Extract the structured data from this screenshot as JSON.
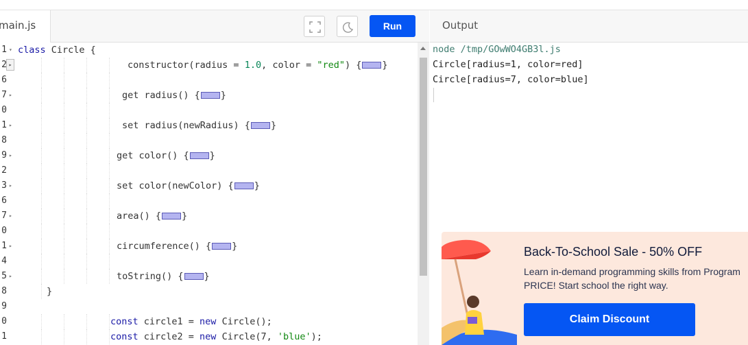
{
  "editor": {
    "file_tab": "main.js",
    "run_label": "Run",
    "icons": {
      "fullscreen": "fullscreen-icon",
      "theme": "moon-icon"
    },
    "lines": [
      {
        "num": "1",
        "fold": "open",
        "indent": 26,
        "guides": 0,
        "parts": [
          [
            "kw",
            "class"
          ],
          [
            "p",
            " Circle {"
          ]
        ]
      },
      {
        "num": "2",
        "fold": "box",
        "indent": 186,
        "guides": 4,
        "parts": [
          [
            "p",
            "constructor(radius = "
          ],
          [
            "num",
            "1.0"
          ],
          [
            "p",
            ", color = "
          ],
          [
            "str",
            "\"red\""
          ],
          [
            "p",
            ") {"
          ],
          [
            "mark",
            ""
          ],
          [
            "p",
            "}"
          ]
        ]
      },
      {
        "num": "6",
        "fold": "",
        "indent": 0,
        "guides": 4,
        "parts": []
      },
      {
        "num": "7",
        "fold": "closed",
        "indent": 178,
        "guides": 4,
        "parts": [
          [
            "p",
            "get radius() {"
          ],
          [
            "mark",
            ""
          ],
          [
            "p",
            "}"
          ]
        ]
      },
      {
        "num": "0",
        "fold": "",
        "indent": 0,
        "guides": 4,
        "parts": []
      },
      {
        "num": "1",
        "fold": "closed",
        "indent": 178,
        "guides": 4,
        "parts": [
          [
            "p",
            "set radius(newRadius) {"
          ],
          [
            "mark",
            ""
          ],
          [
            "p",
            "}"
          ]
        ]
      },
      {
        "num": "8",
        "fold": "",
        "indent": 0,
        "guides": 4,
        "parts": []
      },
      {
        "num": "9",
        "fold": "closed",
        "indent": 170,
        "guides": 4,
        "parts": [
          [
            "p",
            "get color() {"
          ],
          [
            "mark",
            ""
          ],
          [
            "p",
            "}"
          ]
        ]
      },
      {
        "num": "2",
        "fold": "",
        "indent": 0,
        "guides": 4,
        "parts": []
      },
      {
        "num": "3",
        "fold": "closed",
        "indent": 170,
        "guides": 4,
        "parts": [
          [
            "p",
            "set color(newColor) {"
          ],
          [
            "mark",
            ""
          ],
          [
            "p",
            "}"
          ]
        ]
      },
      {
        "num": "6",
        "fold": "",
        "indent": 0,
        "guides": 4,
        "parts": []
      },
      {
        "num": "7",
        "fold": "closed",
        "indent": 170,
        "guides": 4,
        "parts": [
          [
            "p",
            "area() {"
          ],
          [
            "mark",
            ""
          ],
          [
            "p",
            "}"
          ]
        ]
      },
      {
        "num": "0",
        "fold": "",
        "indent": 0,
        "guides": 4,
        "parts": []
      },
      {
        "num": "1",
        "fold": "closed",
        "indent": 170,
        "guides": 4,
        "parts": [
          [
            "p",
            "circumference() {"
          ],
          [
            "mark",
            ""
          ],
          [
            "p",
            "}"
          ]
        ]
      },
      {
        "num": "4",
        "fold": "",
        "indent": 0,
        "guides": 4,
        "parts": []
      },
      {
        "num": "5",
        "fold": "closed",
        "indent": 170,
        "guides": 4,
        "parts": [
          [
            "p",
            "toString() {"
          ],
          [
            "mark",
            ""
          ],
          [
            "p",
            "}"
          ]
        ]
      },
      {
        "num": "8",
        "fold": "",
        "indent": 68,
        "guides": 1,
        "parts": [
          [
            "p",
            "}"
          ]
        ]
      },
      {
        "num": "9",
        "fold": "",
        "indent": 0,
        "guides": 0,
        "parts": []
      },
      {
        "num": "0",
        "fold": "",
        "indent": 161,
        "guides": 4,
        "parts": [
          [
            "kw",
            "const"
          ],
          [
            "p",
            " circle1 = "
          ],
          [
            "kw",
            "new"
          ],
          [
            "p",
            " Circle();"
          ]
        ]
      },
      {
        "num": "1",
        "fold": "",
        "indent": 161,
        "guides": 4,
        "parts": [
          [
            "kw",
            "const"
          ],
          [
            "p",
            " circle2 = "
          ],
          [
            "kw",
            "new"
          ],
          [
            "p",
            " Circle(7, "
          ],
          [
            "str",
            "'blue'"
          ],
          [
            "p",
            ");"
          ]
        ]
      }
    ]
  },
  "output": {
    "title": "Output",
    "command": "node /tmp/GOwWO4GB3l.js",
    "lines": [
      "Circle[radius=1, color=red]",
      "Circle[radius=7, color=blue]"
    ]
  },
  "ad": {
    "title": "Back-To-School Sale - 50% OFF",
    "desc_line1": "Learn in-demand programming skills from Program",
    "desc_line2": "PRICE! Start school the right way.",
    "button": "Claim Discount"
  }
}
